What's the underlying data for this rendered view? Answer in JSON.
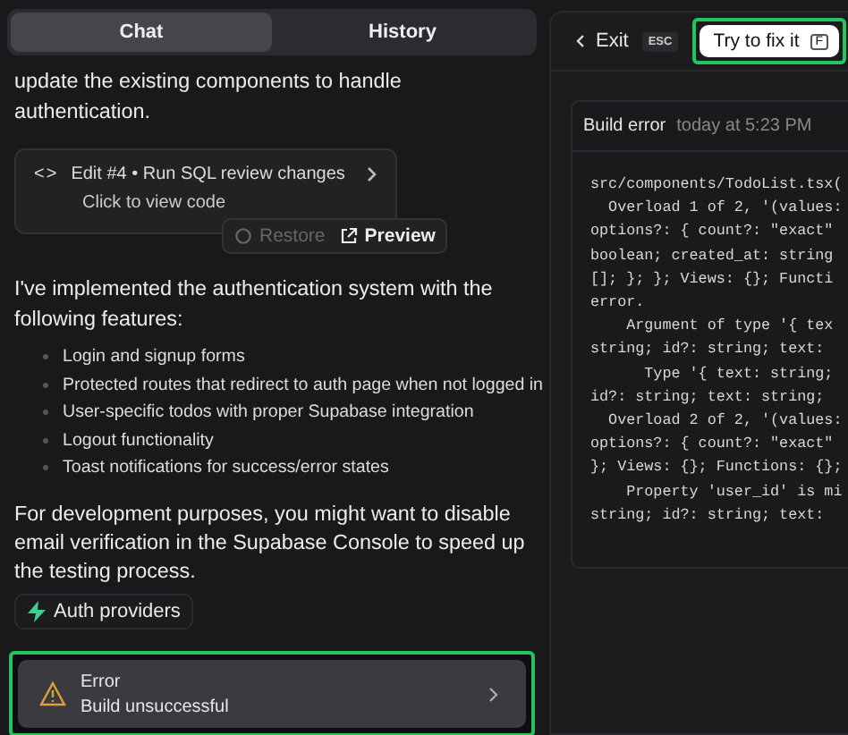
{
  "tabs": [
    {
      "label": "Chat",
      "selected": true
    },
    {
      "label": "History",
      "selected": false
    }
  ],
  "chat": {
    "intro_tail": "update the existing components to handle authentication.",
    "edit_card": {
      "code_glyph": "<>",
      "title": "Edit #4 • Run SQL review changes",
      "subtitle": "Click to view code",
      "actions": [
        {
          "label": "Restore",
          "disabled": true
        },
        {
          "label": "Preview",
          "disabled": false
        }
      ]
    },
    "summary": "I've implemented the authentication system with the following features:",
    "features": [
      "Login and signup forms",
      "Protected routes that redirect to auth page when not logged in",
      "User-specific todos with proper Supabase integration",
      "Logout functionality",
      "Toast notifications for success/error states"
    ],
    "note": "For development purposes, you might want to disable email verification in the Supabase Console to speed up the testing process.",
    "chip": "Auth providers",
    "error_card": {
      "title": "Error",
      "message": "Build unsuccessful",
      "highlighted": true
    }
  },
  "error_panel": {
    "exit": "Exit",
    "exit_key": "ESC",
    "fix_button": {
      "label": "Try to fix it",
      "key": "F",
      "highlighted": true
    },
    "card": {
      "title": "Build error",
      "time": "today at 5:23 PM",
      "code_lines": [
        "src/components/TodoList.tsx(",
        "  Overload 1 of 2, '(values:",
        "options?: { count?: \"exact\"",
        "boolean; created_at: string",
        "[]; }; }; Views: {}; Functi",
        "error.",
        "    Argument of type '{ tex",
        "string; id?: string; text: ",
        "      Type '{ text: string;",
        "id?: string; text: string; ",
        "  Overload 2 of 2, '(values:",
        "options?: { count?: \"exact\"",
        "}; Views: {}; Functions: {};",
        "    Property 'user_id' is mi",
        "string; id?: string; text: "
      ]
    }
  }
}
